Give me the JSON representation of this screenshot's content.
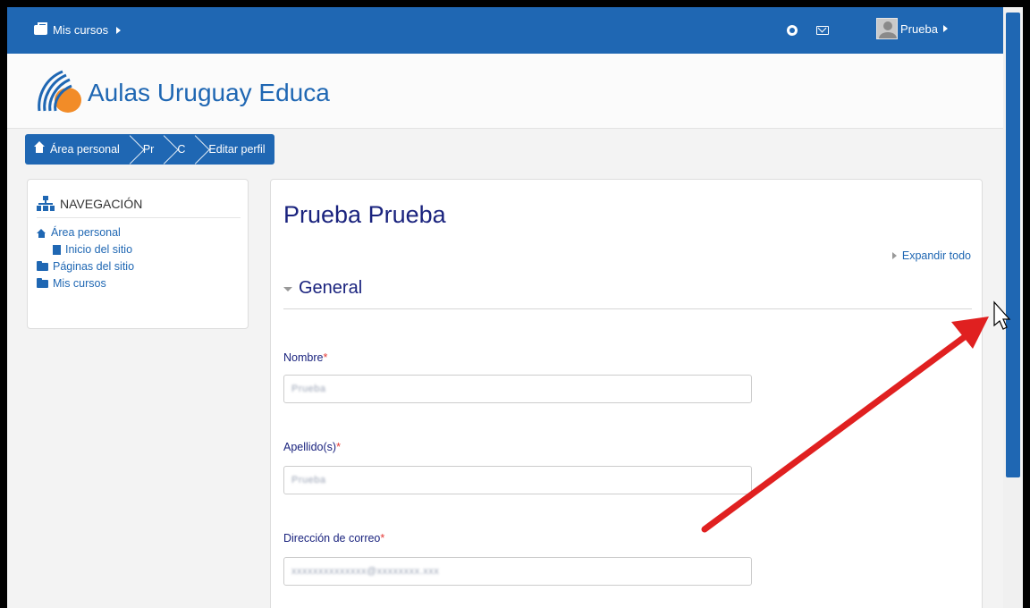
{
  "navbar": {
    "my_courses": "Mis cursos",
    "user_name": "Prueba",
    "icons": [
      "briefcase-icon",
      "help-icon",
      "mail-icon",
      "avatar"
    ]
  },
  "header": {
    "site_title": "Aulas Uruguay Educa"
  },
  "breadcrumb": {
    "items": [
      "Área personal",
      "Pr",
      "C",
      "Editar perfil"
    ]
  },
  "navigation": {
    "title": "NAVEGACIÓN",
    "items": [
      {
        "label": "Área personal",
        "icon": "home-icon"
      },
      {
        "label": "Inicio del sitio",
        "icon": "page-icon"
      },
      {
        "label": "Páginas del sitio",
        "icon": "folder-icon"
      },
      {
        "label": "Mis cursos",
        "icon": "folder-icon"
      }
    ]
  },
  "main": {
    "title": "Prueba Prueba",
    "expand_all": "Expandir todo",
    "section": "General",
    "fields": [
      {
        "label": "Nombre",
        "required": "*",
        "value": "Prueba"
      },
      {
        "label": "Apellido(s)",
        "required": "*",
        "value": "Prueba"
      },
      {
        "label": "Dirección de correo",
        "required": "*",
        "value": "xxxxxxxxxxxxxx@xxxxxxxx.xxx"
      }
    ]
  },
  "colors": {
    "brand_blue": "#1f67b3",
    "title_navy": "#1a237e",
    "required_red": "#e53935",
    "annotation_arrow": "#e02020"
  }
}
